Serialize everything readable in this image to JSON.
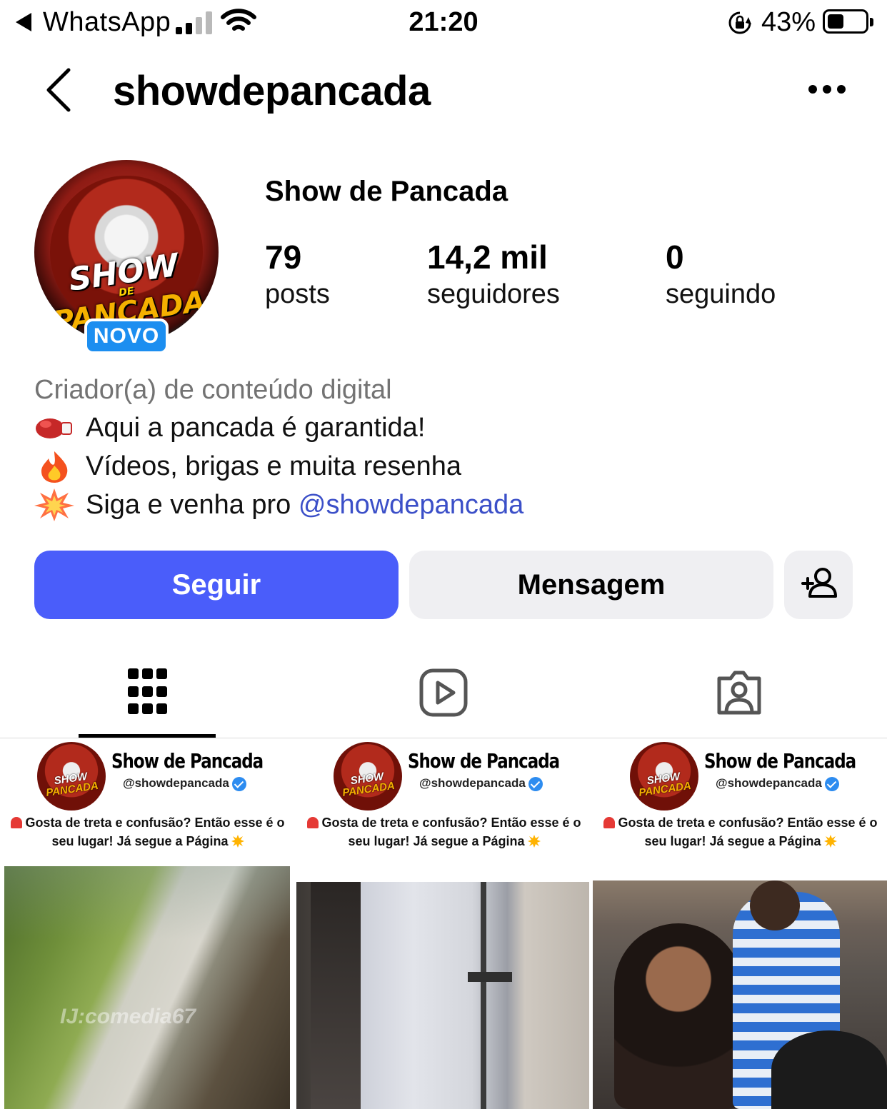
{
  "status_bar": {
    "back_app": "WhatsApp",
    "time": "21:20",
    "battery_pct": "43%",
    "battery_level": 0.43
  },
  "header": {
    "username": "showdepancada"
  },
  "profile": {
    "avatar_text_top": "SHOW",
    "avatar_text_mid": "DE",
    "avatar_text_bottom": "PANCADA",
    "badge": "NOVO",
    "display_name": "Show de Pancada",
    "stats": [
      {
        "value": "79",
        "label": "posts"
      },
      {
        "value": "14,2 mil",
        "label": "seguidores"
      },
      {
        "value": "0",
        "label": "seguindo"
      }
    ],
    "category": "Criador(a) de conteúdo digital",
    "bio": [
      {
        "icon": "boxing-glove-emoji",
        "text": "Aqui a pancada é garantida!"
      },
      {
        "icon": "fire-emoji",
        "text": "Vídeos, brigas e muita resenha"
      },
      {
        "icon": "collision-emoji",
        "text_before": "Siga e venha pro ",
        "link": "@showdepancada"
      }
    ]
  },
  "actions": {
    "follow": "Seguir",
    "message": "Mensagem"
  },
  "colors": {
    "follow_button": "#4a5dfa",
    "secondary_button": "#efeff2",
    "link": "#3b4fc8",
    "badge": "#1c8ef0"
  },
  "tabs": [
    {
      "icon": "grid-icon",
      "active": true
    },
    {
      "icon": "reels-icon",
      "active": false
    },
    {
      "icon": "tagged-icon",
      "active": false
    }
  ],
  "posts": [
    {
      "title": "Show de Pancada",
      "handle": "@showdepancada",
      "caption": "Gosta de treta e confusão? Então esse é o seu lugar! Já segue a Página",
      "watermark": "IJ:comedia67"
    },
    {
      "title": "Show de Pancada",
      "handle": "@showdepancada",
      "caption": "Gosta de treta e confusão? Então esse é o seu lugar! Já segue a Página"
    },
    {
      "title": "Show de Pancada",
      "handle": "@showdepancada",
      "caption": "Gosta de treta e confusão? Então esse é o seu lugar! Já segue a Página"
    }
  ]
}
